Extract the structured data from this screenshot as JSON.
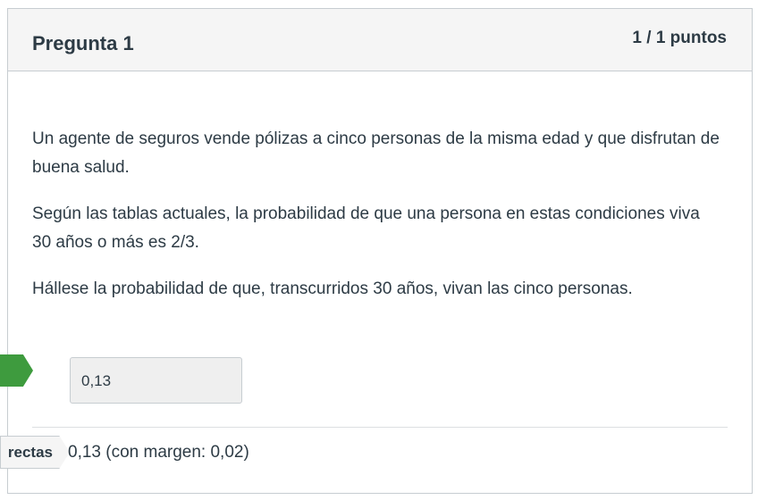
{
  "question": {
    "title": "Pregunta 1",
    "points": "1 / 1 puntos",
    "paragraphs": [
      "Un agente de seguros vende pólizas a cinco personas de la misma edad y que disfrutan de buena salud.",
      "Según las tablas actuales, la probabilidad de que una persona en estas condiciones viva 30 años o más es 2/3.",
      "Hállese la probabilidad de que, transcurridos 30 años, vivan las cinco personas."
    ],
    "answer_value": "0,13",
    "correct_tag_label": "rectas",
    "correct_answer_text": "0,13 (con margen: 0,02)"
  },
  "colors": {
    "correct_marker": "#3e9b3e",
    "header_bg": "#f5f5f5",
    "text": "#2d3b45"
  }
}
